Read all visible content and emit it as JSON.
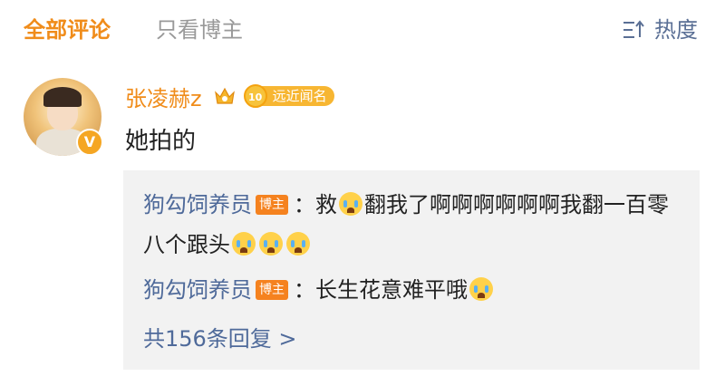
{
  "tabs": {
    "all": "全部评论",
    "blogger_only": "只看博主"
  },
  "sort": {
    "label": "热度",
    "icon": "sort-icon"
  },
  "comment": {
    "username": "张凌赫z",
    "level_number": "10",
    "level_tag": "远近闻名",
    "verified_badge": "V",
    "text": "她拍的"
  },
  "replies": [
    {
      "author": "狗勾饲养员",
      "badge": "博主",
      "sep": "：",
      "part1": "救",
      "part2": "翻我了啊啊啊啊啊啊我翻一百零八个跟头"
    },
    {
      "author": "狗勾饲养员",
      "badge": "博主",
      "sep": "：",
      "part1": "长生花意难平哦"
    }
  ],
  "more_replies": "共156条回复 >",
  "colors": {
    "accent": "#f08c1a",
    "link": "#4f6a9a",
    "reply_bg": "#f2f2f2"
  }
}
